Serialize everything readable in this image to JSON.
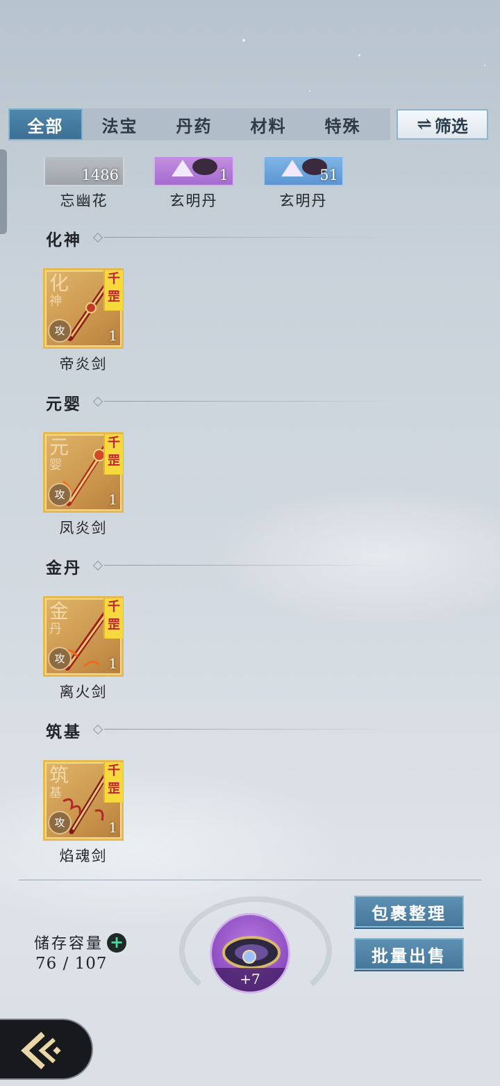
{
  "tabs": [
    {
      "label": "全部",
      "active": true
    },
    {
      "label": "法宝",
      "active": false
    },
    {
      "label": "丹药",
      "active": false
    },
    {
      "label": "材料",
      "active": false
    },
    {
      "label": "特殊",
      "active": false
    }
  ],
  "filter_label": "筛选",
  "top_row": [
    {
      "name": "忘幽花",
      "count": "1486",
      "rarity": "grey"
    },
    {
      "name": "玄明丹",
      "count": "1",
      "rarity": "purple"
    },
    {
      "name": "玄明丹",
      "count": "51",
      "rarity": "blue"
    }
  ],
  "sections": [
    {
      "title": "化神",
      "item": {
        "name": "帝炎剑",
        "realm_big": "化",
        "realm_small": "神",
        "tag": "千罡",
        "type": "攻",
        "count": "1"
      }
    },
    {
      "title": "元婴",
      "item": {
        "name": "凤炎剑",
        "realm_big": "元",
        "realm_small": "婴",
        "tag": "千罡",
        "type": "攻",
        "count": "1"
      }
    },
    {
      "title": "金丹",
      "item": {
        "name": "离火剑",
        "realm_big": "金",
        "realm_small": "丹",
        "tag": "千罡",
        "type": "攻",
        "count": "1"
      }
    },
    {
      "title": "筑基",
      "item": {
        "name": "焰魂剑",
        "realm_big": "筑",
        "realm_small": "基",
        "tag": "千罡",
        "type": "攻",
        "count": "1"
      }
    }
  ],
  "storage": {
    "label": "储存容量",
    "value": "76 / 107"
  },
  "featured": {
    "bonus": "+7",
    "icon": "ring-treasure-icon"
  },
  "buttons": {
    "organize": "包裹整理",
    "bulk_sell": "批量出售"
  },
  "icons": {
    "back": "back-arrow-icon",
    "filter": "swap-arrows-icon",
    "add": "plus-icon"
  }
}
